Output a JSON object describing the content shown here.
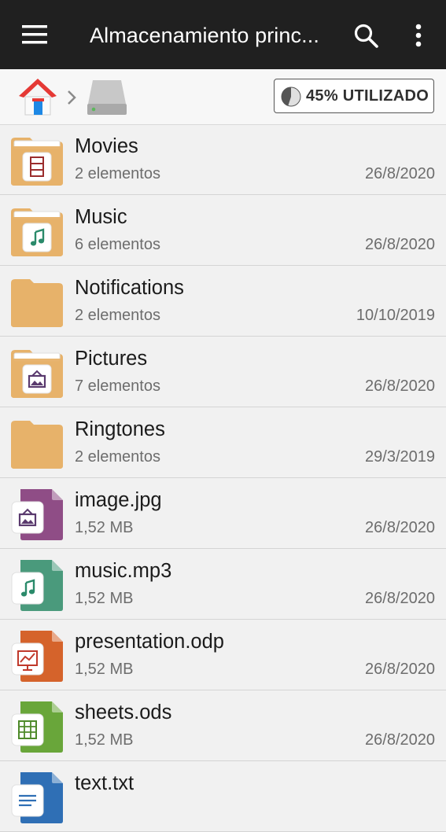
{
  "appbar": {
    "title": "Almacenamiento princ...",
    "menu_icon": "hamburger-menu-icon",
    "search_icon": "search-icon",
    "more_icon": "more-vert-icon"
  },
  "pathbar": {
    "home_icon": "home-icon",
    "separator_icon": "chevron-right-icon",
    "drive_icon": "internal-storage-icon",
    "usage_label": "45% UTILIZADO",
    "usage_fraction": 0.45
  },
  "files": [
    {
      "name": "Movies",
      "meta": "2 elementos",
      "date": "26/8/2020",
      "icon": "folder-movies-icon"
    },
    {
      "name": "Music",
      "meta": "6 elementos",
      "date": "26/8/2020",
      "icon": "folder-music-icon"
    },
    {
      "name": "Notifications",
      "meta": "2 elementos",
      "date": "10/10/2019",
      "icon": "folder-icon"
    },
    {
      "name": "Pictures",
      "meta": "7 elementos",
      "date": "26/8/2020",
      "icon": "folder-pictures-icon"
    },
    {
      "name": "Ringtones",
      "meta": "2 elementos",
      "date": "29/3/2019",
      "icon": "folder-icon"
    },
    {
      "name": "image.jpg",
      "meta": "1,52 MB",
      "date": "26/8/2020",
      "icon": "image-file-icon"
    },
    {
      "name": "music.mp3",
      "meta": "1,52 MB",
      "date": "26/8/2020",
      "icon": "audio-file-icon"
    },
    {
      "name": "presentation.odp",
      "meta": "1,52 MB",
      "date": "26/8/2020",
      "icon": "presentation-file-icon"
    },
    {
      "name": "sheets.ods",
      "meta": "1,52 MB",
      "date": "26/8/2020",
      "icon": "spreadsheet-file-icon"
    },
    {
      "name": "text.txt",
      "meta": "",
      "date": "",
      "icon": "text-file-icon"
    }
  ],
  "colors": {
    "appbar": "#202020",
    "folder": "#e7b26a",
    "image_file": "#8f4d86",
    "audio_file": "#4a9a7c",
    "presentation_file": "#d5632b",
    "spreadsheet_file": "#69a63a",
    "text_file": "#2f6fb5"
  }
}
